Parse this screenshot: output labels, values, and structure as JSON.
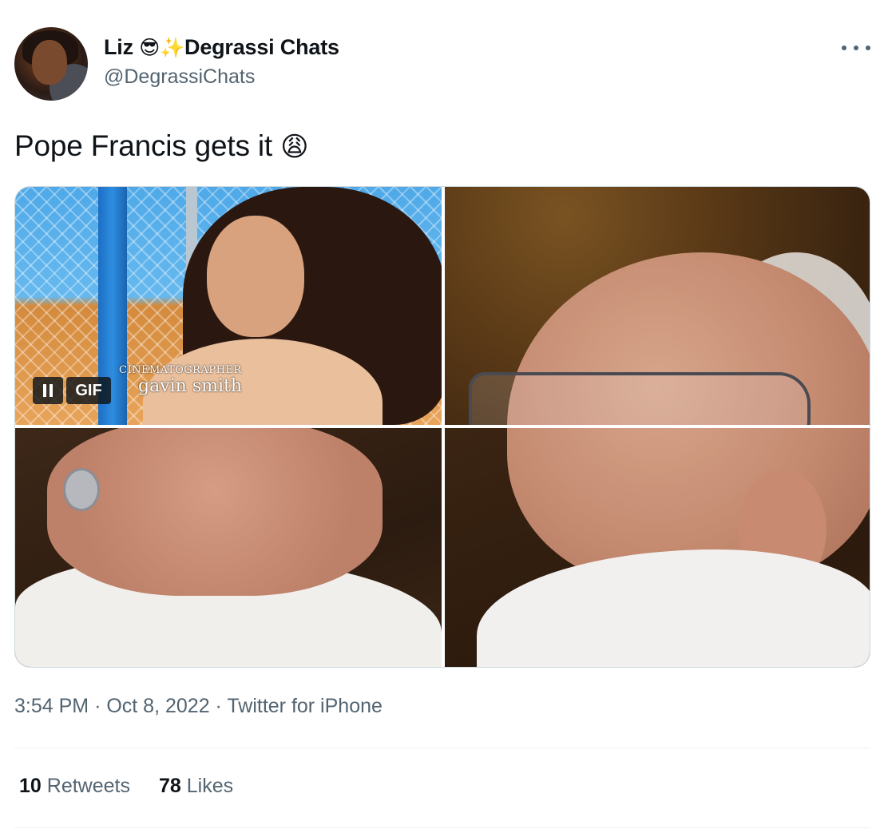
{
  "author": {
    "name": "Liz",
    "name_emojis": "😎✨",
    "name_suffix": "Degrassi Chats",
    "handle": "@DegrassiChats"
  },
  "tweet": {
    "text": "Pope Francis gets it",
    "text_emoji": "😩"
  },
  "media": {
    "gif_label": "GIF",
    "gif_overlay_role": "CINEMATOGRAPHER",
    "gif_overlay_name": "gavin smith"
  },
  "meta": {
    "time": "3:54 PM",
    "date": "Oct 8, 2022",
    "source": "Twitter for iPhone",
    "separator": "·"
  },
  "stats": {
    "retweets_count": "10",
    "retweets_label": "Retweets",
    "likes_count": "78",
    "likes_label": "Likes"
  },
  "icons": {
    "more": "more-dots-icon",
    "pause": "pause-icon"
  },
  "colors": {
    "text_primary": "#0f1419",
    "text_secondary": "#536471",
    "border": "#cfd9de"
  }
}
